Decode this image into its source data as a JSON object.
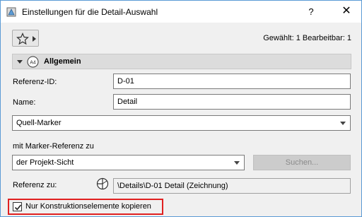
{
  "window": {
    "title": "Einstellungen für die Detail-Auswahl",
    "help_label": "?",
    "close_label": "✕"
  },
  "toolbar": {
    "selection_info": "Gewählt: 1 Bearbeitbar: 1"
  },
  "section": {
    "title": "Allgemein",
    "icon_text": "A4"
  },
  "fields": {
    "referenz_id_label": "Referenz-ID:",
    "referenz_id_value": "D-01",
    "name_label": "Name:",
    "name_value": "Detail"
  },
  "source_marker": {
    "selected": "Quell-Marker"
  },
  "marker_ref": {
    "label": "mit Marker-Referenz zu",
    "selected": "der Projekt-Sicht",
    "search_label": "Suchen..."
  },
  "reference": {
    "label": "Referenz zu:",
    "value": "\\Details\\D-01 Detail (Zeichnung)"
  },
  "option": {
    "checked": true,
    "label": "Nur Konstruktionselemente kopieren"
  },
  "colors": {
    "accent_border": "#e02020",
    "window_border": "#5b9bd5"
  }
}
